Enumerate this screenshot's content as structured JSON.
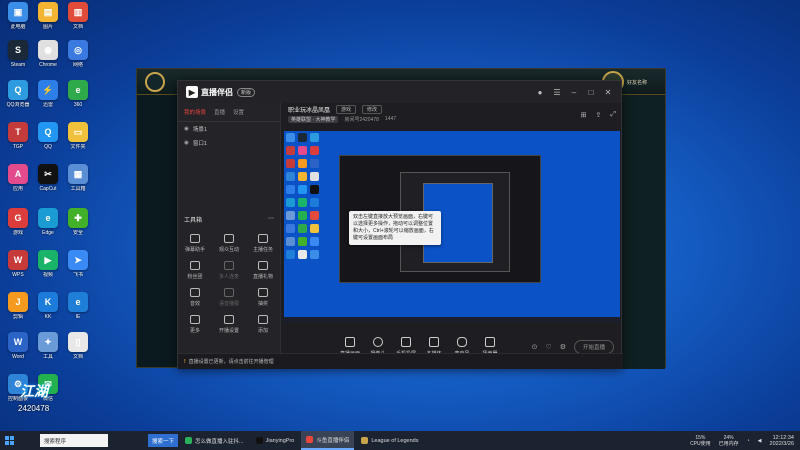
{
  "desktop": {
    "icons": [
      {
        "label": "此电脑",
        "color": "#3b8ee8",
        "glyph": "▣"
      },
      {
        "label": "Steam",
        "color": "#1b2838",
        "glyph": "S"
      },
      {
        "label": "QQ浏览器",
        "color": "#2d9be0",
        "glyph": "Q"
      },
      {
        "label": "TGP",
        "color": "#c43b3b",
        "glyph": "T"
      },
      {
        "label": "应用",
        "color": "#e34b8c",
        "glyph": "A"
      },
      {
        "label": "游戏",
        "color": "#db3d3d",
        "glyph": "G"
      },
      {
        "label": "WPS",
        "color": "#c63a3a",
        "glyph": "W"
      },
      {
        "label": "剪辑",
        "color": "#f39a1f",
        "glyph": "J"
      },
      {
        "label": "Word",
        "color": "#2b63c7",
        "glyph": "W"
      },
      {
        "label": "控制面板",
        "color": "#2e84d6",
        "glyph": "⚙"
      },
      {
        "label": "图片",
        "color": "#f2b431",
        "glyph": "▤"
      },
      {
        "label": "Chrome",
        "color": "#e0e0e0",
        "glyph": "◉"
      },
      {
        "label": "迅雷",
        "color": "#2d7ee8",
        "glyph": "⚡"
      },
      {
        "label": "QQ",
        "color": "#2196f3",
        "glyph": "Q"
      },
      {
        "label": "CapCut",
        "color": "#111111",
        "glyph": "✂"
      },
      {
        "label": "Edge",
        "color": "#1a9bd4",
        "glyph": "e"
      },
      {
        "label": "视频",
        "color": "#19b36a",
        "glyph": "▶"
      },
      {
        "label": "KK",
        "color": "#1d7bdb",
        "glyph": "K"
      },
      {
        "label": "工具",
        "color": "#6a9ad8",
        "glyph": "✦"
      },
      {
        "label": "微信",
        "color": "#22b14c",
        "glyph": "✉"
      },
      {
        "label": "文档",
        "color": "#e04b3a",
        "glyph": "▥"
      },
      {
        "label": "网络",
        "color": "#3a7ae0",
        "glyph": "◎"
      },
      {
        "label": "360",
        "color": "#2eaa4a",
        "glyph": "e"
      },
      {
        "label": "文件夹",
        "color": "#f0c13b",
        "glyph": "▭"
      },
      {
        "label": "工具箱",
        "color": "#5a8fd6",
        "glyph": "▦"
      },
      {
        "label": "安全",
        "color": "#43b02a",
        "glyph": "✚"
      },
      {
        "label": "飞书",
        "color": "#3a8af5",
        "glyph": "➤"
      },
      {
        "label": "IE",
        "color": "#1f7fd8",
        "glyph": "e"
      },
      {
        "label": "文档",
        "color": "#e8e8e8",
        "glyph": "▯"
      }
    ]
  },
  "lol": {
    "title": "League of Legends",
    "friend_name": "好友名称"
  },
  "app": {
    "logo_text": "直播伴侣",
    "version": "新版",
    "tabs": [
      "我的场景",
      "直播",
      "设置"
    ],
    "scenes": [
      "场景1",
      "窗口1"
    ],
    "toolbox_title": "工具箱",
    "tools": [
      {
        "label": "弹幕助手",
        "dim": false
      },
      {
        "label": "观众互动",
        "dim": false
      },
      {
        "label": "主播任务",
        "dim": false
      },
      {
        "label": "粉丝团",
        "dim": false
      },
      {
        "label": "多人连麦",
        "dim": true
      },
      {
        "label": "直播礼物",
        "dim": false
      },
      {
        "label": "音效",
        "dim": false
      },
      {
        "label": "语音播报",
        "dim": true
      },
      {
        "label": "抽奖",
        "dim": false
      },
      {
        "label": "更多",
        "dim": false
      },
      {
        "label": "开播设置",
        "dim": false
      },
      {
        "label": "添加",
        "dim": false
      }
    ],
    "stream_title": "职业玩冰晶凤凰",
    "category": "游戏",
    "edit_label": "修改",
    "channel": "英雄联盟 · 大神教学",
    "room_info": "房间号2420478",
    "likes": "1447",
    "tooltip_text": "双击左键直接放大预览画面，右键可以选择更多操作，拖动可以调整位置和大小，Ctrl+滚轮可以缩放画面，右键可设置画面布局",
    "bottom_items": [
      "直播画面",
      "摄像头",
      "手机投屏",
      "多媒体",
      "麦克风",
      "扬声器"
    ],
    "live_button": "开始直播",
    "notice_text": "直播设置已更新，请点击前往开播管理"
  },
  "watermark": {
    "brand": "江湖",
    "number": "2420478"
  },
  "taskbar": {
    "search_text": "搜索程序",
    "search_button": "搜索一下",
    "tasks": [
      {
        "label": "怎么做直播入驻抖...",
        "color": "#2ab05a",
        "active": false
      },
      {
        "label": "JianyingPro",
        "color": "#111111",
        "active": false
      },
      {
        "label": "斗鱼直播伴侣",
        "color": "#e8473c",
        "active": true
      },
      {
        "label": "League of Legends",
        "color": "#c8a54a",
        "active": false
      }
    ],
    "cpu": "15%",
    "cpu_label": "CPU使用",
    "mem": "24%",
    "mem_label": "已用内存",
    "time": "12:12:34",
    "date": "2022/3/26"
  }
}
